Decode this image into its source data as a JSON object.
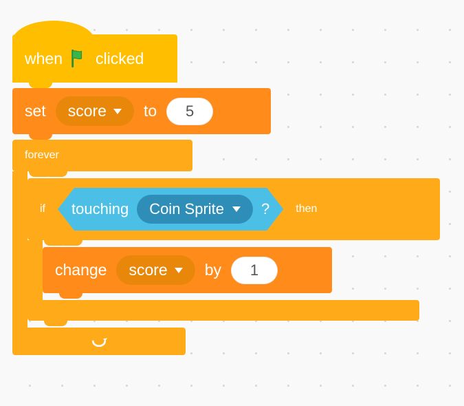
{
  "hat": {
    "prefix": "when",
    "suffix": "clicked",
    "icon": "green-flag"
  },
  "set_block": {
    "op": "set",
    "variable": "score",
    "mid": "to",
    "value": "5"
  },
  "forever": {
    "label": "forever"
  },
  "if_block": {
    "if": "if",
    "then": "then"
  },
  "touching": {
    "label": "touching",
    "target": "Coin Sprite",
    "suffix": "?"
  },
  "change_block": {
    "op": "change",
    "variable": "score",
    "mid": "by",
    "value": "1"
  }
}
